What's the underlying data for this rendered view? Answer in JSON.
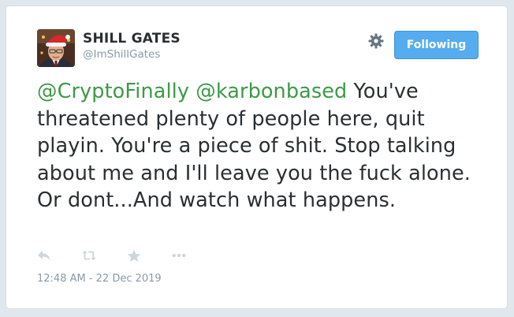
{
  "user": {
    "display_name": "SHILL GATES",
    "handle": "@ImShillGates"
  },
  "follow_button": {
    "label": "Following"
  },
  "tweet": {
    "mention_1": "@CryptoFinally",
    "mention_2": "@karbonbased",
    "body": " You've threatened plenty of people here, quit playin. You're a piece of shit. Stop talking about me and I'll leave you the fuck alone. Or dont...And watch what happens.",
    "timestamp": "12:48 AM - 22 Dec 2019"
  },
  "actions": [
    "reply-icon",
    "retweet-icon",
    "like-star-icon",
    "more-icon"
  ],
  "colors": {
    "mention": "#3c9a46",
    "follow_button": "#55acee",
    "icon": "#ccd6dd",
    "muted_text": "#8899a6"
  }
}
